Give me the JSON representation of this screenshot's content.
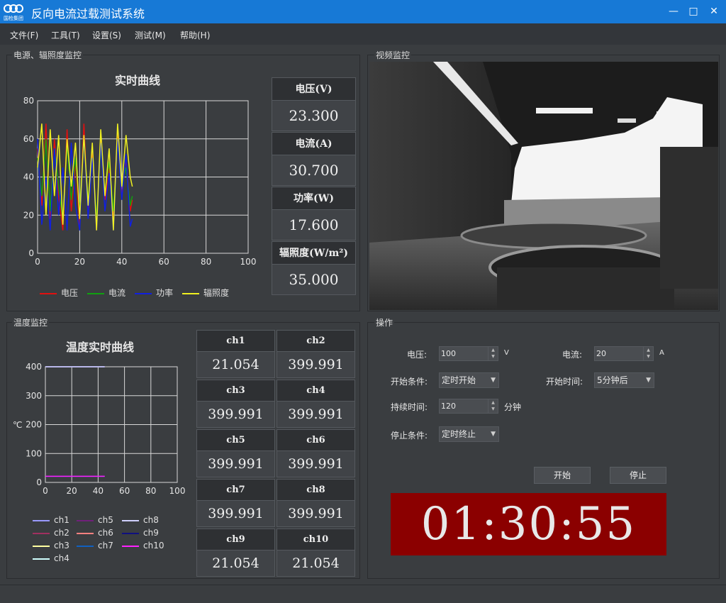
{
  "window": {
    "title": "反向电流过载测试系统",
    "logo_text": "国检集团",
    "colors": {
      "titlebar": "#1779d6",
      "timer_bg": "#8b0000"
    }
  },
  "menu": [
    "文件(F)",
    "工具(T)",
    "设置(S)",
    "测试(M)",
    "帮助(H)"
  ],
  "power_panel": {
    "title": "电源、辐照度监控",
    "chart_title": "实时曲线",
    "readouts": [
      {
        "label": "电压(V)",
        "value": "23.300"
      },
      {
        "label": "电流(A)",
        "value": "30.700"
      },
      {
        "label": "功率(W)",
        "value": "17.600"
      },
      {
        "label": "辐照度(W/m²)",
        "value": "35.000"
      }
    ]
  },
  "video_panel": {
    "title": "视频监控"
  },
  "temp_panel": {
    "title": "温度监控",
    "chart_title": "温度实时曲线",
    "channels": [
      {
        "label": "ch1",
        "value": "21.054"
      },
      {
        "label": "ch2",
        "value": "399.991"
      },
      {
        "label": "ch3",
        "value": "399.991"
      },
      {
        "label": "ch4",
        "value": "399.991"
      },
      {
        "label": "ch5",
        "value": "399.991"
      },
      {
        "label": "ch6",
        "value": "399.991"
      },
      {
        "label": "ch7",
        "value": "399.991"
      },
      {
        "label": "ch8",
        "value": "399.991"
      },
      {
        "label": "ch9",
        "value": "21.054"
      },
      {
        "label": "ch10",
        "value": "21.054"
      }
    ]
  },
  "ops_panel": {
    "title": "操作",
    "voltage_label": "电压:",
    "voltage_value": "100",
    "voltage_unit": "V",
    "current_label": "电流:",
    "current_value": "20",
    "current_unit": "A",
    "start_cond_label": "开始条件:",
    "start_cond_value": "定时开始",
    "start_time_label": "开始时间:",
    "start_time_value": "5分钟后",
    "duration_label": "持续时间:",
    "duration_value": "120",
    "duration_unit": "分钟",
    "stop_cond_label": "停止条件:",
    "stop_cond_value": "定时终止",
    "start_button": "开始",
    "stop_button": "停止",
    "timer": "01:30:55"
  },
  "chart_data": [
    {
      "type": "line",
      "title": "实时曲线",
      "xlim": [
        0,
        100
      ],
      "ylim": [
        0,
        80
      ],
      "xticks": [
        "0",
        "20",
        "40",
        "60",
        "80",
        "100"
      ],
      "yticks": [
        "0",
        "20",
        "40",
        "60",
        "80"
      ],
      "grid": true,
      "legend": "bottom",
      "series": [
        {
          "name": "电压",
          "color": "#e01010",
          "x": [
            0,
            2,
            4,
            6,
            8,
            10,
            12,
            14,
            16,
            18,
            20,
            22,
            24,
            26,
            28,
            30,
            32,
            34,
            36,
            38,
            40,
            42,
            44,
            45
          ],
          "values": [
            55,
            25,
            68,
            18,
            60,
            30,
            12,
            65,
            22,
            48,
            15,
            68,
            20,
            55,
            12,
            62,
            28,
            45,
            18,
            65,
            30,
            50,
            22,
            28
          ]
        },
        {
          "name": "电流",
          "color": "#10a010",
          "x": [
            0,
            2,
            4,
            6,
            8,
            10,
            12,
            14,
            16,
            18,
            20,
            22,
            24,
            26,
            28,
            30,
            32,
            34,
            36,
            38,
            40,
            42,
            44,
            45
          ],
          "values": [
            50,
            30,
            60,
            22,
            55,
            35,
            18,
            58,
            28,
            50,
            22,
            60,
            28,
            50,
            18,
            55,
            32,
            48,
            22,
            58,
            35,
            45,
            25,
            30
          ]
        },
        {
          "name": "功率",
          "color": "#1020e0",
          "x": [
            0,
            2,
            4,
            6,
            8,
            10,
            12,
            14,
            16,
            18,
            20,
            22,
            24,
            26,
            28,
            30,
            32,
            34,
            36,
            38,
            40,
            42,
            44,
            45
          ],
          "values": [
            60,
            15,
            40,
            12,
            55,
            20,
            45,
            12,
            58,
            25,
            12,
            62,
            18,
            50,
            12,
            58,
            22,
            42,
            12,
            60,
            28,
            52,
            14,
            18
          ]
        },
        {
          "name": "辐照度",
          "color": "#f0f020",
          "x": [
            0,
            2,
            4,
            6,
            8,
            10,
            12,
            14,
            16,
            18,
            20,
            22,
            24,
            26,
            28,
            30,
            32,
            34,
            36,
            38,
            40,
            42,
            44,
            45
          ],
          "values": [
            45,
            68,
            20,
            65,
            30,
            62,
            15,
            60,
            35,
            58,
            18,
            62,
            25,
            58,
            12,
            65,
            30,
            55,
            12,
            68,
            35,
            62,
            40,
            35
          ]
        }
      ]
    },
    {
      "type": "line",
      "title": "温度实时曲线",
      "ylabel": "℃",
      "xlim": [
        0,
        100
      ],
      "ylim": [
        0,
        400
      ],
      "xticks": [
        "0",
        "20",
        "40",
        "60",
        "80",
        "100"
      ],
      "yticks": [
        "0",
        "100",
        "200",
        "300",
        "400"
      ],
      "grid": true,
      "legend": "bottom",
      "series": [
        {
          "name": "ch1",
          "color": "#9a9aff",
          "x": [
            0,
            45
          ],
          "values": [
            21.054,
            21.054
          ]
        },
        {
          "name": "ch2",
          "color": "#a03060",
          "x": [
            0,
            45
          ],
          "values": [
            399.991,
            399.991
          ]
        },
        {
          "name": "ch3",
          "color": "#ffffa0",
          "x": [
            0,
            45
          ],
          "values": [
            399.991,
            399.991
          ]
        },
        {
          "name": "ch4",
          "color": "#d0ffff",
          "x": [
            0,
            45
          ],
          "values": [
            399.991,
            399.991
          ]
        },
        {
          "name": "ch5",
          "color": "#70207a",
          "x": [
            0,
            45
          ],
          "values": [
            399.991,
            399.991
          ]
        },
        {
          "name": "ch6",
          "color": "#ff8080",
          "x": [
            0,
            45
          ],
          "values": [
            399.991,
            399.991
          ]
        },
        {
          "name": "ch7",
          "color": "#1060c0",
          "x": [
            0,
            45
          ],
          "values": [
            399.991,
            399.991
          ]
        },
        {
          "name": "ch8",
          "color": "#d0d0ff",
          "x": [
            0,
            45
          ],
          "values": [
            399.991,
            399.991
          ]
        },
        {
          "name": "ch9",
          "color": "#101080",
          "x": [
            0,
            45
          ],
          "values": [
            21.054,
            21.054
          ]
        },
        {
          "name": "ch10",
          "color": "#ff20ff",
          "x": [
            0,
            45
          ],
          "values": [
            21.054,
            21.054
          ]
        }
      ]
    }
  ]
}
